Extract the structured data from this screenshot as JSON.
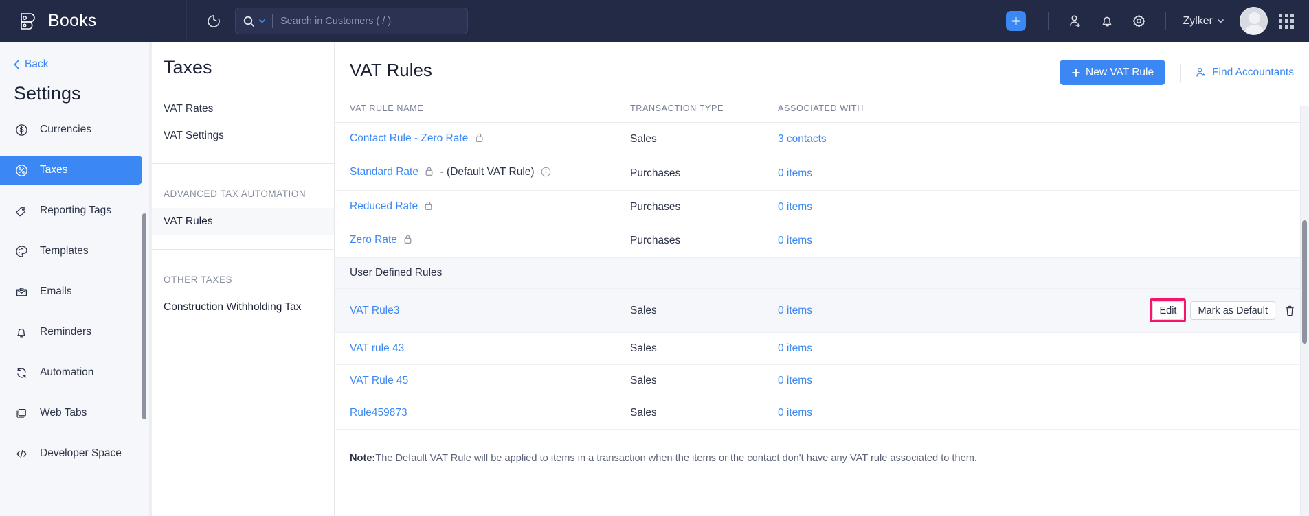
{
  "topbar": {
    "brand": "Books",
    "brand_logo_icon": "books-logo-icon",
    "refresh_icon": "refresh-icon",
    "search": {
      "icon": "search-icon",
      "dropdown_icon": "chevron-down-icon",
      "placeholder": "Search in Customers ( / )",
      "value": ""
    },
    "add_button_icon": "plus-icon",
    "referral_icon": "refer-friend-icon",
    "notifications_icon": "bell-icon",
    "settings_icon": "gear-icon",
    "org_name": "Zylker",
    "org_chevron_icon": "chevron-down-icon",
    "avatar_icon": "user-avatar",
    "apps_icon": "app-grid-icon",
    "accent": "#3b88f5",
    "background": "#232a45"
  },
  "sidebar": {
    "back_label": "Back",
    "back_icon": "chevron-left-icon",
    "title": "Settings",
    "items": [
      {
        "label": "Currencies",
        "icon": "currency-dollar-icon",
        "active": false
      },
      {
        "label": "Taxes",
        "icon": "percent-circle-icon",
        "active": true
      },
      {
        "label": "Reporting Tags",
        "icon": "tag-icon",
        "active": false
      },
      {
        "label": "Templates",
        "icon": "palette-icon",
        "active": false
      },
      {
        "label": "Emails",
        "icon": "envelope-icon",
        "active": false
      },
      {
        "label": "Reminders",
        "icon": "bell-icon",
        "active": false
      },
      {
        "label": "Automation",
        "icon": "refresh-cycle-icon",
        "active": false
      },
      {
        "label": "Web Tabs",
        "icon": "layers-icon",
        "active": false
      },
      {
        "label": "Developer Space",
        "icon": "code-brackets-icon",
        "active": false
      }
    ]
  },
  "taxes_panel": {
    "title": "Taxes",
    "links": [
      {
        "label": "VAT Rates",
        "selected": false
      },
      {
        "label": "VAT Settings",
        "selected": false
      }
    ],
    "sections": [
      {
        "label": "ADVANCED TAX AUTOMATION",
        "items": [
          {
            "label": "VAT Rules",
            "selected": true
          }
        ]
      },
      {
        "label": "OTHER TAXES",
        "items": [
          {
            "label": "Construction Withholding Tax",
            "selected": false
          }
        ]
      }
    ]
  },
  "main": {
    "page_title": "VAT Rules",
    "new_button_label": "New VAT Rule",
    "new_button_icon": "plus-icon",
    "find_accountants_label": "Find Accountants",
    "find_accountants_icon": "accountant-person-icon",
    "table": {
      "headers": [
        "VAT RULE NAME",
        "TRANSACTION TYPE",
        "ASSOCIATED WITH",
        ""
      ],
      "rows": [
        {
          "name": "Contact Rule - Zero Rate",
          "locked": true,
          "suffix": "",
          "info": false,
          "type": "Sales",
          "associated": "3 contacts",
          "actions": false,
          "hover": false
        },
        {
          "name": "Standard Rate",
          "locked": true,
          "suffix": "- (Default VAT Rule)",
          "info": true,
          "type": "Purchases",
          "associated": "0 items",
          "actions": false,
          "hover": false
        },
        {
          "name": "Reduced Rate",
          "locked": true,
          "suffix": "",
          "info": false,
          "type": "Purchases",
          "associated": "0 items",
          "actions": false,
          "hover": false
        },
        {
          "name": "Zero Rate",
          "locked": true,
          "suffix": "",
          "info": false,
          "type": "Purchases",
          "associated": "0 items",
          "actions": false,
          "hover": false
        }
      ],
      "group_label": "User Defined Rules",
      "user_rows": [
        {
          "name": "VAT Rule3",
          "locked": false,
          "suffix": "",
          "info": false,
          "type": "Sales",
          "associated": "0 items",
          "actions": true,
          "hover": true
        },
        {
          "name": "VAT rule 43",
          "locked": false,
          "suffix": "",
          "info": false,
          "type": "Sales",
          "associated": "0 items",
          "actions": false,
          "hover": false
        },
        {
          "name": "VAT Rule 45",
          "locked": false,
          "suffix": "",
          "info": false,
          "type": "Sales",
          "associated": "0 items",
          "actions": false,
          "hover": false
        },
        {
          "name": "Rule459873",
          "locked": false,
          "suffix": "",
          "info": false,
          "type": "Sales",
          "associated": "0 items",
          "actions": false,
          "hover": false
        }
      ]
    },
    "row_actions": {
      "edit_label": "Edit",
      "mark_default_label": "Mark as Default",
      "delete_icon": "trash-icon",
      "highlight_color": "#f5136c"
    },
    "note_prefix": "Note:",
    "note_text": "The Default VAT Rule will be applied to items in a transaction when the items or the contact don't have any VAT rule associated to them."
  }
}
